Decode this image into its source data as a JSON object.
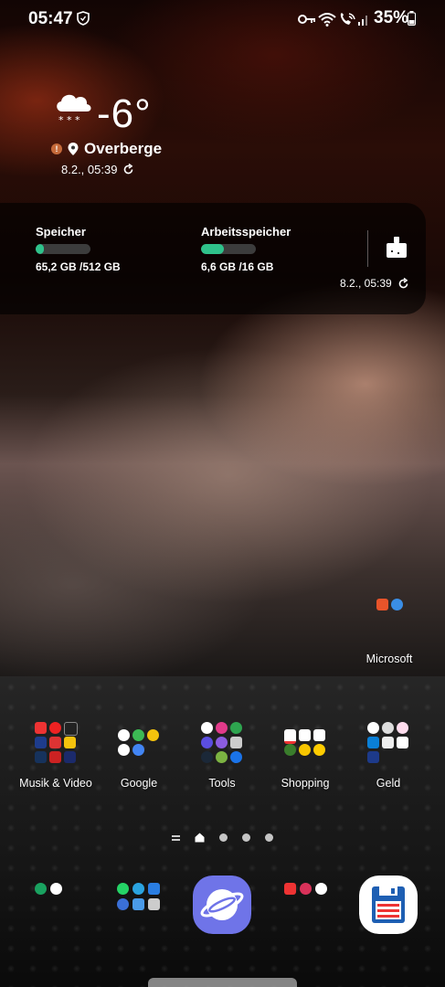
{
  "status": {
    "time": "05:47",
    "battery": "35%",
    "icons": [
      "shield-icon",
      "key-icon",
      "wifi-icon",
      "wifi-call-icon",
      "signal-icon",
      "battery-icon"
    ]
  },
  "weather": {
    "temperature": "-6°",
    "location": "Overberge",
    "updated": "8.2., 05:39",
    "icon": "snow-cloud-icon"
  },
  "storage": {
    "storage_label": "Speicher",
    "storage_value": "65,2 GB /512 GB",
    "storage_fill": 0.13,
    "ram_label": "Arbeitsspeicher",
    "ram_value": "6,6 GB /16 GB",
    "ram_fill": 0.41,
    "updated": "8.2., 05:39",
    "accent": "#2fc28b"
  },
  "folders": {
    "microsoft": "Microsoft",
    "musik": "Musik & Video",
    "google": "Google",
    "tools": "Tools",
    "shopping": "Shopping",
    "geld": "Geld"
  },
  "pager": {
    "current_page": 1,
    "page_count": 3
  }
}
